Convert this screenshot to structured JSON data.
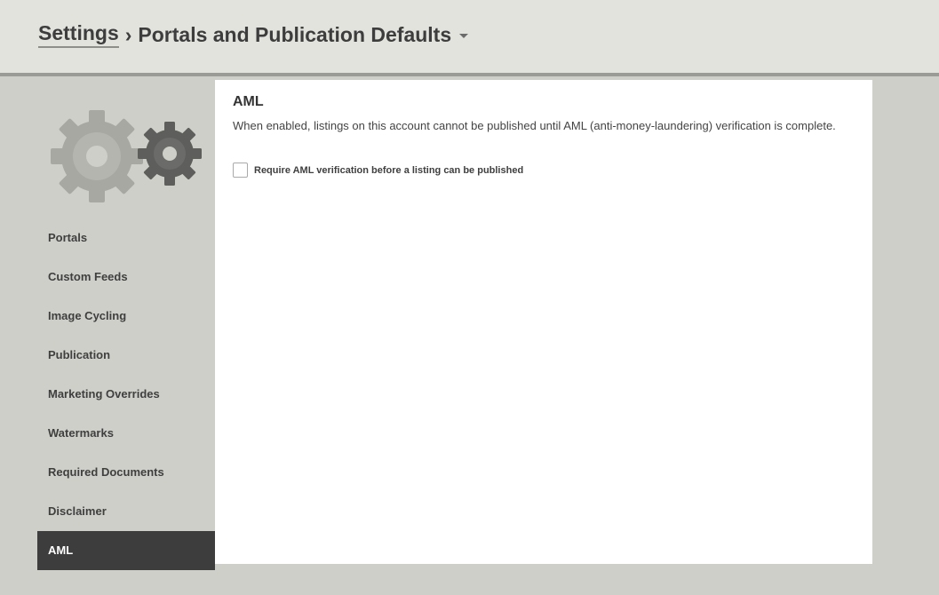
{
  "header": {
    "breadcrumb_root": "Settings",
    "breadcrumb_separator": "›",
    "breadcrumb_current": "Portals and Publication Defaults"
  },
  "sidebar": {
    "icon": "gears-icon",
    "items": [
      {
        "label": "Portals",
        "active": false
      },
      {
        "label": "Custom Feeds",
        "active": false
      },
      {
        "label": "Image Cycling",
        "active": false
      },
      {
        "label": "Publication",
        "active": false
      },
      {
        "label": "Marketing Overrides",
        "active": false
      },
      {
        "label": "Watermarks",
        "active": false
      },
      {
        "label": "Required Documents",
        "active": false
      },
      {
        "label": "Disclaimer",
        "active": false
      },
      {
        "label": "AML",
        "active": true
      }
    ]
  },
  "main": {
    "title": "AML",
    "description": "When enabled, listings on this account cannot be published until AML (anti-money-laundering) verification is complete.",
    "checkbox": {
      "label": "Require AML verification before a listing can be published",
      "checked": false
    }
  },
  "colors": {
    "header_bg": "#e3e3de",
    "page_bg": "#cfcfca",
    "active_nav_bg": "#3d3d3d",
    "gear_large": "#a8a8a3",
    "gear_small": "#5e5e5c"
  }
}
